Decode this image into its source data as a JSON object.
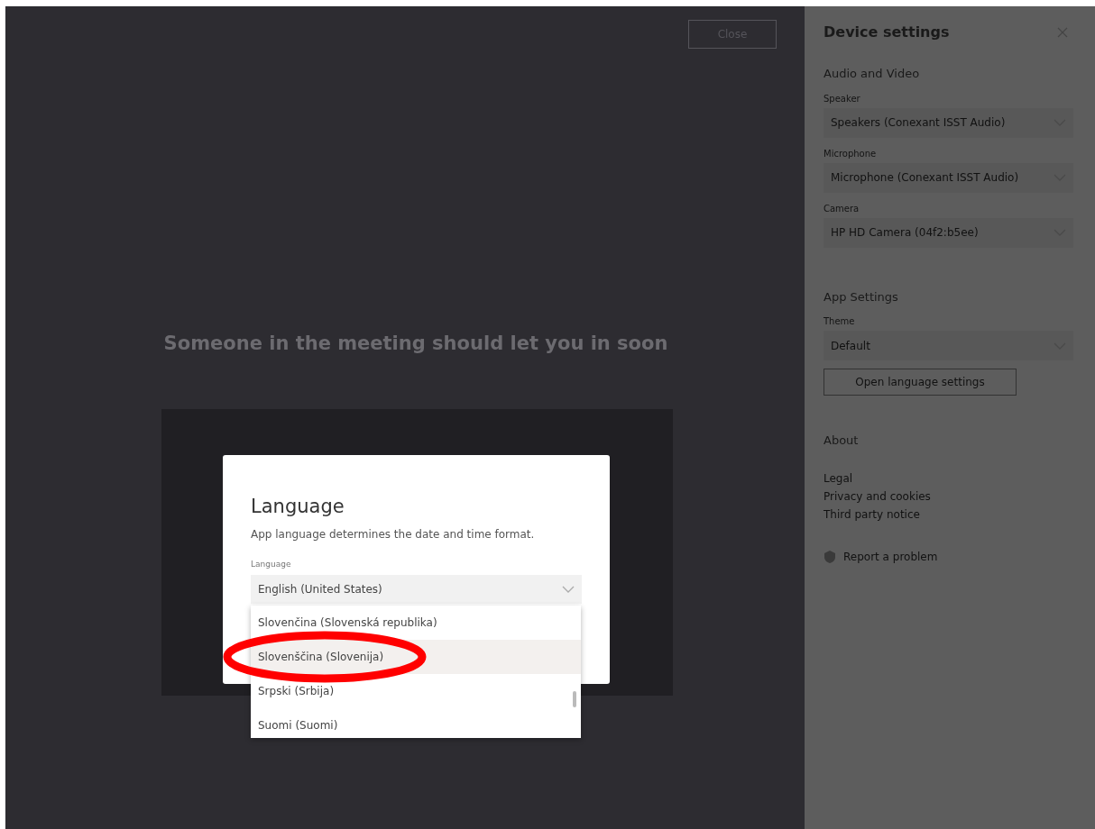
{
  "main": {
    "close_button": "Close",
    "status": "Someone in the meeting should let you in soon"
  },
  "dialog": {
    "title": "Language",
    "description": "App language determines the date and time format.",
    "field_label": "Language",
    "value": "English (United States)",
    "options": [
      {
        "label": "Slovenčina (Slovenská republika)",
        "selected": false
      },
      {
        "label": "Slovenščina (Slovenija)",
        "selected": true
      },
      {
        "label": "Srpski (Srbija)",
        "selected": false
      },
      {
        "label": "Suomi (Suomi)",
        "selected": false
      }
    ]
  },
  "annotation": {
    "kind": "ellipse"
  },
  "device_settings": {
    "title": "Device settings",
    "sections": [
      {
        "heading": "Audio and Video",
        "items": [
          {
            "kind": "select",
            "label": "Speaker",
            "value": "Speakers (Conexant ISST Audio)"
          },
          {
            "kind": "select",
            "label": "Microphone",
            "value": "Microphone (Conexant ISST Audio)"
          },
          {
            "kind": "select",
            "label": "Camera",
            "value": "HP HD Camera (04f2:b5ee)"
          }
        ]
      },
      {
        "heading": "App Settings",
        "items": [
          {
            "kind": "select",
            "label": "Theme",
            "value": "Default"
          },
          {
            "kind": "button",
            "label": "Open language settings"
          }
        ]
      },
      {
        "heading": "About",
        "items": [
          {
            "kind": "links",
            "links": [
              "Legal",
              "Privacy and cookies",
              "Third party notice"
            ]
          }
        ]
      }
    ],
    "report": "Report a problem"
  }
}
